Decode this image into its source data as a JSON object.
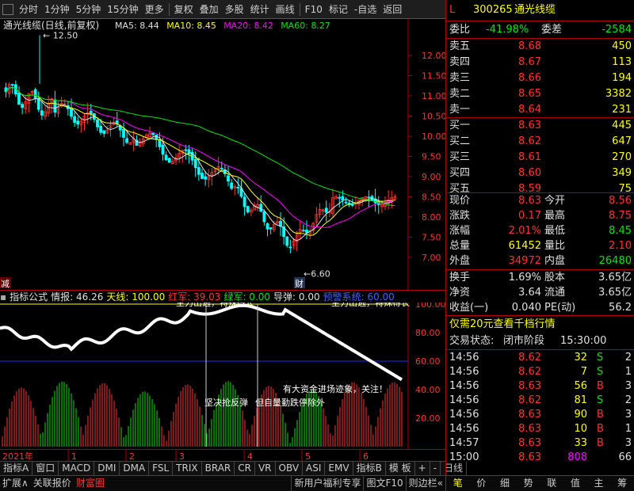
{
  "toolbar": {
    "items": [
      "分时",
      "1分钟",
      "5分钟",
      "15分钟",
      "更多",
      "复权",
      "叠加",
      "多股",
      "统计",
      "画线",
      "F10",
      "标记",
      "-自选",
      "返回"
    ]
  },
  "chart": {
    "title": "通光线缆(日线,前复权)",
    "ma": [
      {
        "label": "MA5: 8.44",
        "color": "#e0e0e0"
      },
      {
        "label": "MA10: 8.45",
        "color": "#ffff00"
      },
      {
        "label": "MA20: 8.42",
        "color": "#ff00ff"
      },
      {
        "label": "MA60: 8.27",
        "color": "#00e600"
      }
    ],
    "high_label": "12.50",
    "low_label": "6.60",
    "left_marker": "减",
    "cai_marker": "财",
    "yticks": [
      "12.00",
      "11.50",
      "11.00",
      "10.50",
      "10.00",
      "9.50",
      "9.00",
      "8.50",
      "8.00",
      "7.50",
      "7.00"
    ],
    "colors": {
      "up": "#ff3232",
      "down": "#00ffff",
      "ma5": "#e0e0e0",
      "ma10": "#ffff00",
      "ma20": "#ff00ff",
      "ma60": "#00e600"
    }
  },
  "indicator": {
    "bar": [
      {
        "t": "指标公式",
        "c": "#e0e0e0"
      },
      {
        "t": "情报: 46.26",
        "c": "#e0e0e0"
      },
      {
        "t": "天线: 100.00",
        "c": "#ffff00"
      },
      {
        "t": "红军: 39.03",
        "c": "#ff3232"
      },
      {
        "t": "绿军: 0.00",
        "c": "#00e600"
      },
      {
        "t": "导弹: 0.00",
        "c": "#e0e0e0"
      },
      {
        "t": "预警系统: 60.00",
        "c": "#4060ff"
      }
    ],
    "yticks": [
      "100.00",
      "80.00",
      "60.00",
      "40.00",
      "20.00"
    ],
    "texts": {
      "t1": "坚决抢反弹",
      "t2": "但自量勤跌停除外",
      "t3": "有大资金进场迹象，关注！",
      "t4": "主力出逃，特殊得长",
      "t5": "主力出逃，特殊得长"
    }
  },
  "dates": {
    "year": "2021年",
    "months": [
      "1",
      "2",
      "3",
      "4",
      "5",
      "6"
    ]
  },
  "tabs": [
    "指标A",
    "窗口",
    "MACD",
    "DMI",
    "DMA",
    "FSL",
    "TRIX",
    "BRAR",
    "CR",
    "VR",
    "OBV",
    "ASI",
    "EMV",
    "指标B",
    "模 板",
    "+",
    "-",
    "日线"
  ],
  "bottom": {
    "left": [
      "扩展∧",
      "关联报价",
      "财富圈"
    ],
    "right": [
      "新用户福利专享",
      "图文F10",
      "则边栏«"
    ],
    "tabs2": [
      "笔",
      "价",
      "细",
      "势",
      "联",
      "值",
      "主",
      "筹"
    ]
  },
  "quote": {
    "flag": "L",
    "code": "300265",
    "name": "通光线缆",
    "wb_label": "委比",
    "wb": "-41.98%",
    "wc_label": "委差",
    "wc": "-2584",
    "sell": [
      {
        "l": "卖五",
        "p": "8.68",
        "v": "450"
      },
      {
        "l": "卖四",
        "p": "8.67",
        "v": "113"
      },
      {
        "l": "卖三",
        "p": "8.66",
        "v": "194"
      },
      {
        "l": "卖二",
        "p": "8.65",
        "v": "3382"
      },
      {
        "l": "卖一",
        "p": "8.64",
        "v": "231"
      }
    ],
    "buy": [
      {
        "l": "买一",
        "p": "8.63",
        "v": "445"
      },
      {
        "l": "买二",
        "p": "8.62",
        "v": "647"
      },
      {
        "l": "买三",
        "p": "8.61",
        "v": "270"
      },
      {
        "l": "买四",
        "p": "8.60",
        "v": "349"
      },
      {
        "l": "买五",
        "p": "8.59",
        "v": "75"
      }
    ],
    "stats": [
      [
        {
          "l": "现价",
          "v": "8.63",
          "c": "red"
        },
        {
          "l": "今开",
          "v": "8.56",
          "c": "red"
        }
      ],
      [
        {
          "l": "涨跌",
          "v": "0.17",
          "c": "red"
        },
        {
          "l": "最高",
          "v": "8.75",
          "c": "red"
        }
      ],
      [
        {
          "l": "涨幅",
          "v": "2.01%",
          "c": "red"
        },
        {
          "l": "最低",
          "v": "8.45",
          "c": "green"
        }
      ],
      [
        {
          "l": "总量",
          "v": "61452",
          "c": "yel"
        },
        {
          "l": "量比",
          "v": "2.10",
          "c": "red"
        }
      ],
      [
        {
          "l": "外盘",
          "v": "34972",
          "c": "red"
        },
        {
          "l": "内盘",
          "v": "26480",
          "c": "green"
        }
      ]
    ],
    "stats2": [
      [
        {
          "l": "换手",
          "v": "1.69%"
        },
        {
          "l": "股本",
          "v": "3.65亿"
        }
      ],
      [
        {
          "l": "净资",
          "v": "3.64"
        },
        {
          "l": "流通",
          "v": "3.65亿"
        }
      ],
      [
        {
          "l": "收益(一)",
          "v": "0.040"
        },
        {
          "l": "PE(动)",
          "v": "56.2"
        }
      ]
    ],
    "promo": "仅需20元查看千档行情",
    "status_label": "交易状态:",
    "status": "闭市阶段",
    "status_time": "15:30:00",
    "ticks": [
      {
        "t": "14:56",
        "p": "8.62",
        "v": "32",
        "s": "S"
      },
      {
        "t": "14:56",
        "p": "8.62",
        "v": "7",
        "s": "S"
      },
      {
        "t": "14:56",
        "p": "8.63",
        "v": "56",
        "s": "B"
      },
      {
        "t": "14:56",
        "p": "8.62",
        "v": "81",
        "s": "S"
      },
      {
        "t": "14:56",
        "p": "8.63",
        "v": "90",
        "s": "B"
      },
      {
        "t": "14:56",
        "p": "8.63",
        "v": "10",
        "s": "B"
      },
      {
        "t": "14:57",
        "p": "8.63",
        "v": "33",
        "s": "B"
      },
      {
        "t": "15:00",
        "p": "8.63",
        "v": "808",
        "s": ""
      }
    ],
    "tick_nums": [
      "2",
      "1",
      "3",
      "2",
      "3",
      "1",
      "3",
      "66"
    ]
  }
}
